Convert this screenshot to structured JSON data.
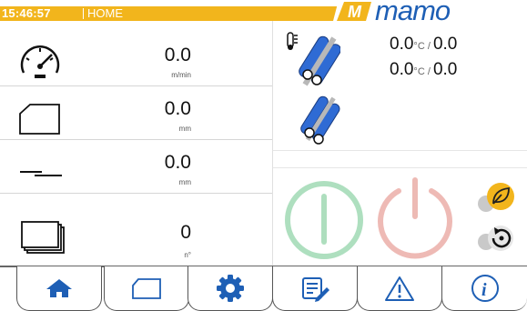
{
  "header": {
    "time": "15:46:57",
    "page": "HOME",
    "brand": "mamo",
    "bar_color": "#f2b51c",
    "logo_color": "#1e5fb5"
  },
  "readings": [
    {
      "icon": "speedometer-icon",
      "value": "0.0",
      "unit": "m/min"
    },
    {
      "icon": "sheet-length-icon",
      "value": "0.0",
      "unit": "mm"
    },
    {
      "icon": "thickness-icon",
      "value": "0.0",
      "unit": "mm"
    },
    {
      "icon": "sheet-stack-icon",
      "value": "0",
      "unit": "n°"
    }
  ],
  "temperatures": [
    {
      "value": "0.0",
      "unit": "°C",
      "target": "0.0"
    },
    {
      "value": "0.0",
      "unit": "°C",
      "target": "0.0"
    }
  ],
  "controls": {
    "start_color": "#6cc48a",
    "stop_color": "#e08278",
    "eco_color": "#f2b51c"
  },
  "tabs": [
    {
      "icon": "home-icon",
      "name": "tab-home"
    },
    {
      "icon": "sheet-icon",
      "name": "tab-sheet"
    },
    {
      "icon": "gear-icon",
      "name": "tab-settings"
    },
    {
      "icon": "edit-list-icon",
      "name": "tab-recipes"
    },
    {
      "icon": "warning-icon",
      "name": "tab-alarms"
    },
    {
      "icon": "info-icon",
      "name": "tab-info"
    }
  ]
}
